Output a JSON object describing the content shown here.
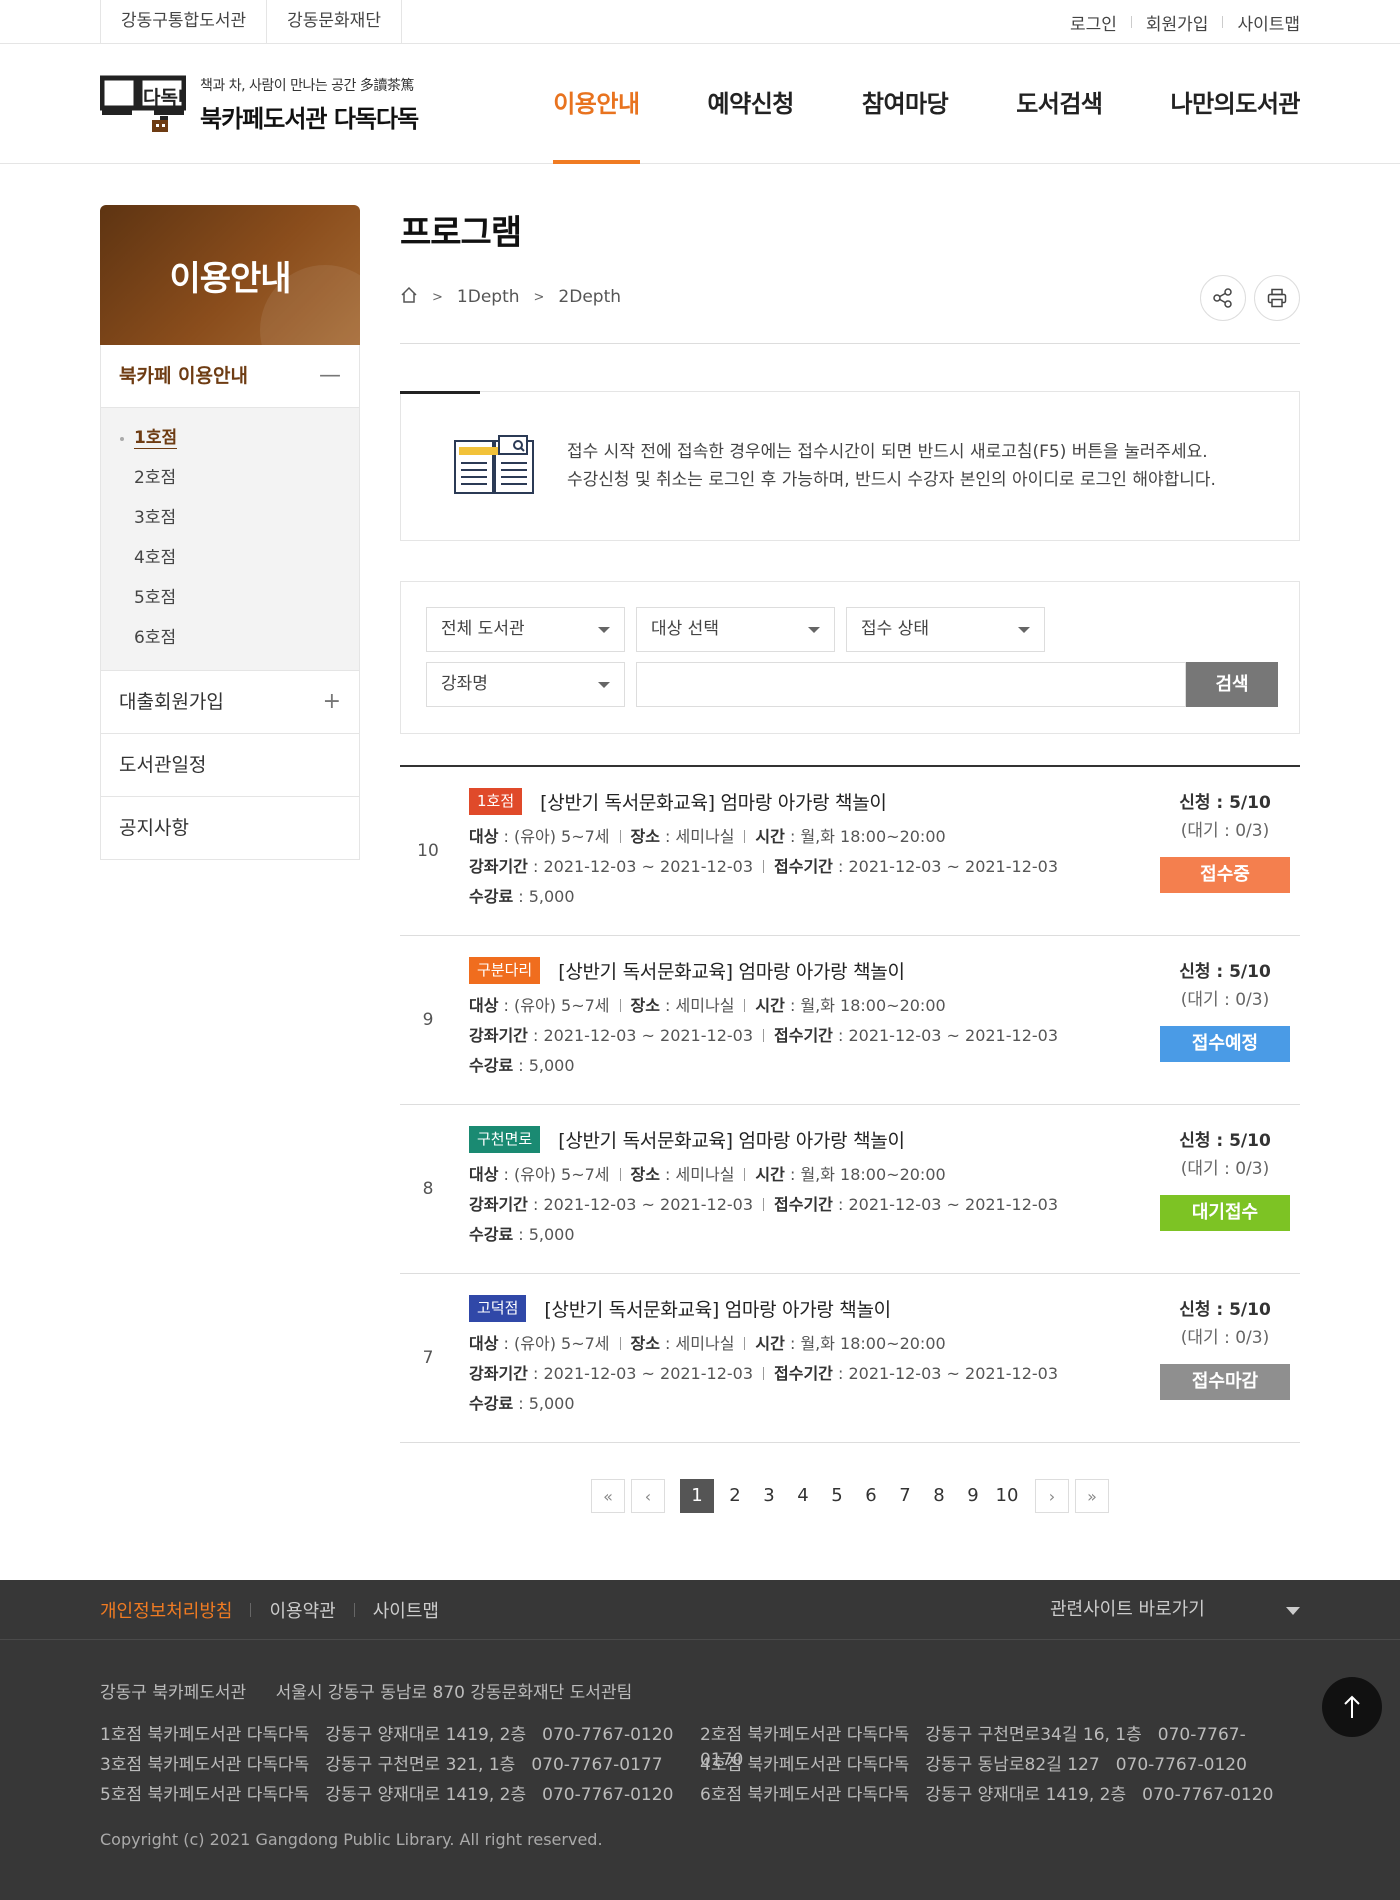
{
  "topbar": {
    "left_links": [
      "강동구통합도서관",
      "강동문화재단"
    ],
    "right_links": [
      "로그인",
      "회원가입",
      "사이트맵"
    ]
  },
  "logo": {
    "mark_text": "다독다독",
    "tagline": "책과 차, 사람이 만나는 공간 多讀茶篤",
    "name": "북카페도서관 다독다독"
  },
  "gnb": [
    "이용안내",
    "예약신청",
    "참여마당",
    "도서검색",
    "나만의도서관"
  ],
  "gnb_active_color": "#f07b22",
  "lnb": {
    "title": "이용안내",
    "items": [
      {
        "label": "북카페 이용안내",
        "toggle": "—"
      },
      {
        "label": "대출회원가입",
        "toggle": "+"
      },
      {
        "label": "도서관일정",
        "toggle": ""
      },
      {
        "label": "공지사항",
        "toggle": ""
      }
    ],
    "sub_items": [
      "1호점",
      "2호점",
      "3호점",
      "4호점",
      "5호점",
      "6호점"
    ]
  },
  "page": {
    "title": "프로그램",
    "breadcrumb": [
      "1Depth",
      "2Depth"
    ]
  },
  "notice": {
    "line1": "접수 시작 전에 접속한 경우에는 접수시간이 되면 반드시 새로고침(F5) 버튼을 눌러주세요.",
    "line2": "수강신청 및 취소는 로그인 후 가능하며, 반드시 수강자 본인의 아이디로 로그인 해야합니다."
  },
  "search": {
    "library": "전체 도서관",
    "target": "대상 선택",
    "status": "접수 상태",
    "field": "강좌명",
    "query": "",
    "button": "검색"
  },
  "labels": {
    "target": "대상",
    "place": "장소",
    "time": "시간",
    "course_period": "강좌기간",
    "apply_period": "접수기간",
    "fee": "수강료"
  },
  "programs": [
    {
      "num": "10",
      "branch": "1호점",
      "branch_color": "#e04a2a",
      "title": "[상반기 독서문화교육] 엄마랑 아가랑 책놀이",
      "target": " : (유아) 5~7세",
      "place": " : 세미나실",
      "time": " : 월,화 18:00~20:00",
      "course_period": " : 2021-12-03 ~ 2021-12-03",
      "apply_period": " : 2021-12-03 ~ 2021-12-03",
      "fee": " :  5,000",
      "applied": "신청 : 5/10",
      "waiting": "(대기 : 0/3)",
      "status": "접수중",
      "status_color": "#f47f4e"
    },
    {
      "num": "9",
      "branch": "구분다리",
      "branch_color": "#f06d1e",
      "title": "[상반기 독서문화교육] 엄마랑 아가랑 책놀이",
      "target": " : (유아) 5~7세",
      "place": " : 세미나실",
      "time": " : 월,화 18:00~20:00",
      "course_period": " : 2021-12-03 ~ 2021-12-03",
      "apply_period": " : 2021-12-03 ~ 2021-12-03",
      "fee": " :  5,000",
      "applied": "신청 : 5/10",
      "waiting": "(대기 : 0/3)",
      "status": "접수예정",
      "status_color": "#4a9be6"
    },
    {
      "num": "8",
      "branch": "구천면로",
      "branch_color": "#1a8a72",
      "title": "[상반기 독서문화교육] 엄마랑 아가랑 책놀이",
      "target": " : (유아) 5~7세",
      "place": " : 세미나실",
      "time": " : 월,화 18:00~20:00",
      "course_period": " : 2021-12-03 ~ 2021-12-03",
      "apply_period": " : 2021-12-03 ~ 2021-12-03",
      "fee": " :  5,000",
      "applied": "신청 : 5/10",
      "waiting": "(대기 : 0/3)",
      "status": "대기접수",
      "status_color": "#7dc324"
    },
    {
      "num": "7",
      "branch": "고덕점",
      "branch_color": "#3048a8",
      "title": "[상반기 독서문화교육] 엄마랑 아가랑 책놀이",
      "target": " : (유아) 5~7세",
      "place": " : 세미나실",
      "time": " : 월,화 18:00~20:00",
      "course_period": " : 2021-12-03 ~ 2021-12-03",
      "apply_period": " : 2021-12-03 ~ 2021-12-03",
      "fee": " :  5,000",
      "applied": "신청 : 5/10",
      "waiting": "(대기 : 0/3)",
      "status": "접수마감",
      "status_color": "#8f8f8f"
    }
  ],
  "pagination": {
    "first": "«",
    "prev": "‹",
    "next": "›",
    "last": "»",
    "pages": [
      "1",
      "2",
      "3",
      "4",
      "5",
      "6",
      "7",
      "8",
      "9",
      "10"
    ],
    "current": "1"
  },
  "footer": {
    "links": [
      "개인정보처리방침",
      "이용약관",
      "사이트맵"
    ],
    "family_site": "관련사이트 바로가기",
    "org": "강동구 북카페도서관",
    "address": "서울시 강동구 동남로 870 강동문화재단 도서관팀",
    "branches": [
      {
        "name": "1호점 북카페도서관 다독다독",
        "addr": "강동구 양재대로 1419, 2층",
        "tel": "070-7767-0120"
      },
      {
        "name": "2호점 북카페도서관 다독다독",
        "addr": "강동구 구천면로34길 16, 1층",
        "tel": "070-7767-0170"
      },
      {
        "name": "3호점 북카페도서관 다독다독",
        "addr": "강동구 구천면로 321, 1층",
        "tel": "070-7767-0177"
      },
      {
        "name": "4호점 북카페도서관 다독다독",
        "addr": "강동구 동남로82길 127",
        "tel": "070-7767-0120"
      },
      {
        "name": "5호점 북카페도서관 다독다독",
        "addr": "강동구 양재대로 1419, 2층",
        "tel": "070-7767-0120"
      },
      {
        "name": "6호점 북카페도서관 다독다독",
        "addr": "강동구 양재대로 1419, 2층",
        "tel": "070-7767-0120"
      }
    ],
    "copyright": "Copyright (c) 2021 Gangdong Public Library. All right reserved."
  }
}
